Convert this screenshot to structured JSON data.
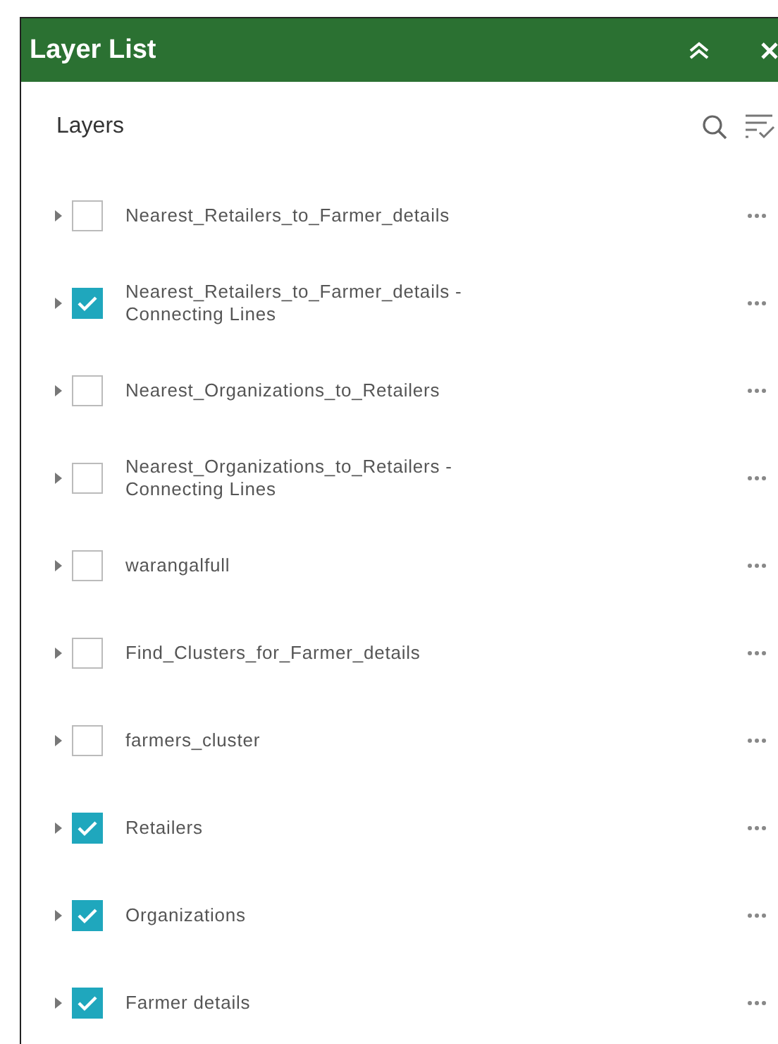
{
  "panel": {
    "title": "Layer List"
  },
  "section": {
    "title": "Layers"
  },
  "layers": [
    {
      "name": "Nearest_Retailers_to_Farmer_details",
      "checked": false
    },
    {
      "name": "Nearest_Retailers_to_Farmer_details - Connecting Lines",
      "checked": true
    },
    {
      "name": "Nearest_Organizations_to_Retailers",
      "checked": false
    },
    {
      "name": "Nearest_Organizations_to_Retailers - Connecting Lines",
      "checked": false
    },
    {
      "name": "warangalfull",
      "checked": false
    },
    {
      "name": "Find_Clusters_for_Farmer_details",
      "checked": false
    },
    {
      "name": "farmers_cluster",
      "checked": false
    },
    {
      "name": "Retailers",
      "checked": true
    },
    {
      "name": "Organizations",
      "checked": true
    },
    {
      "name": "Farmer details",
      "checked": true
    }
  ]
}
